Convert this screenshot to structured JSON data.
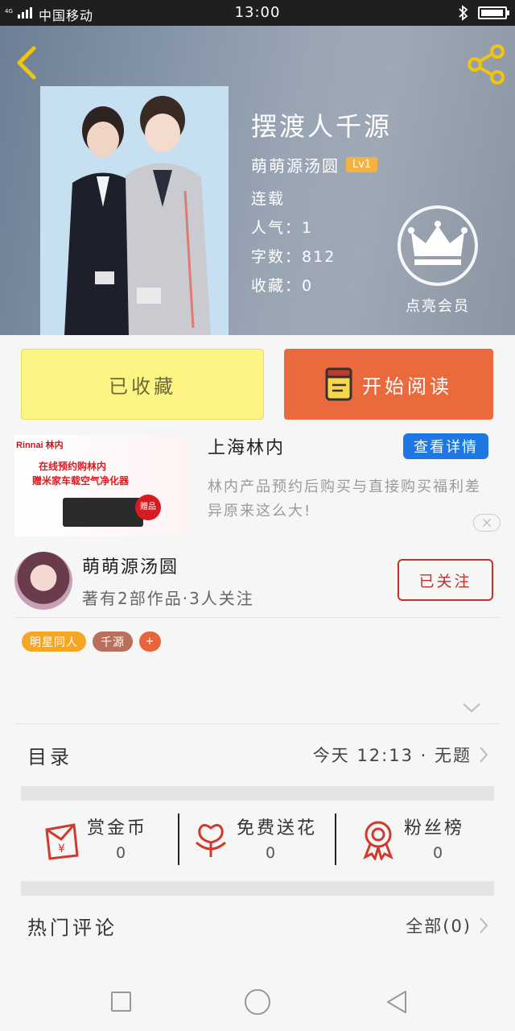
{
  "status_bar": {
    "network": "4G",
    "carrier": "中国移动",
    "time": "13:00"
  },
  "book": {
    "title": "摆渡人千源",
    "author": "萌萌源汤圆",
    "level_badge": "Lv1",
    "status": "连载",
    "popularity_label": "人气：",
    "popularity": "1",
    "word_count_label": "字数：",
    "word_count": "812",
    "favorites_label": "收藏：",
    "favorites": "0",
    "vip_label": "点亮会员"
  },
  "actions": {
    "collected_label": "已收藏",
    "read_label": "开始阅读"
  },
  "ad": {
    "brand": "Rinnai 林内",
    "image_line1": "在线预约购林内",
    "image_line2": "赠米家车载空气净化器",
    "image_stamp": "赠品",
    "title": "上海林内",
    "detail_button": "查看详情",
    "description": "林内产品预约后购买与直接购买福利差异原来这么大!"
  },
  "author_card": {
    "name": "萌萌源汤圆",
    "stats": "著有2部作品·3人关注",
    "follow_label": "已关注"
  },
  "tags": [
    {
      "label": "明星同人",
      "color": "#f5a623"
    },
    {
      "label": "千源",
      "color": "#b86f5b"
    },
    {
      "label": "+",
      "color": "#e8643a"
    }
  ],
  "toc": {
    "title": "目录",
    "latest": "今天 12:13 · 无题"
  },
  "stats": [
    {
      "label": "赏金币",
      "value": "0",
      "icon": "red-envelope-icon"
    },
    {
      "label": "免费送花",
      "value": "0",
      "icon": "flower-icon"
    },
    {
      "label": "粉丝榜",
      "value": "0",
      "icon": "medal-icon"
    }
  ],
  "comments": {
    "title": "热门评论",
    "all_label": "全部(0)"
  },
  "colors": {
    "accent_orange": "#eb6a3d",
    "collect_yellow": "#fdf583",
    "follow_red": "#c0312b",
    "ad_blue": "#1e77e2"
  }
}
